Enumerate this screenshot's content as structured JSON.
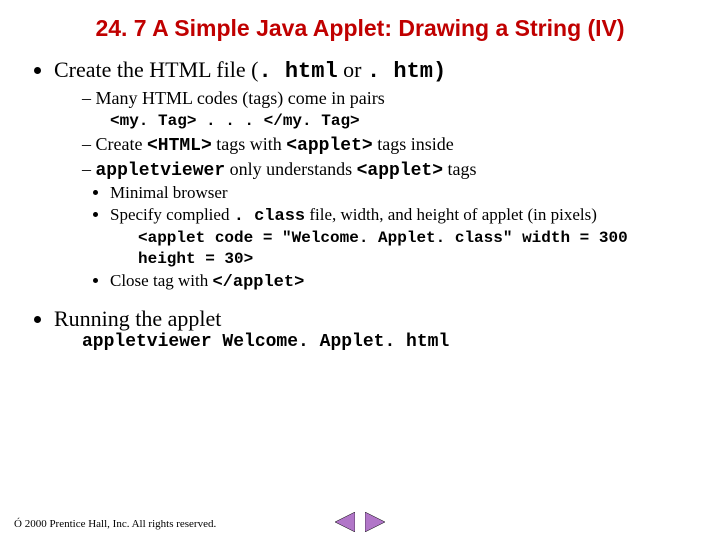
{
  "title": "24. 7   A Simple Java Applet: Drawing a String (IV)",
  "b1": {
    "text_a": "Create the HTML file (",
    "ext1": ". html",
    "text_b": " or ",
    "ext2": ". htm)",
    "sub1": "Many HTML codes (tags) come in pairs",
    "code1": "<my. Tag> . . . </my. Tag>",
    "sub2_a": "Create ",
    "sub2_html": "<HTML>",
    "sub2_b": " tags with ",
    "sub2_applet": "<applet>",
    "sub2_c": " tags inside",
    "sub3_a": "appletviewer",
    "sub3_b": " only understands ",
    "sub3_applet": "<applet>",
    "sub3_c": " tags",
    "sub3_i1": "Minimal browser",
    "sub3_i2_a": "Specify complied ",
    "sub3_i2_class": ". class",
    "sub3_i2_b": " file, width, and height of applet (in pixels)",
    "applet_code_l1": "<applet code = \"Welcome. Applet. class\" width = 300",
    "applet_code_l2": "    height = 30>",
    "sub3_i3_a": "Close tag with ",
    "sub3_i3_code": "</applet>"
  },
  "b2": {
    "text": "Running the applet",
    "code": "appletviewer Welcome. Applet. html"
  },
  "footer": "Ó 2000 Prentice Hall, Inc.  All rights reserved."
}
